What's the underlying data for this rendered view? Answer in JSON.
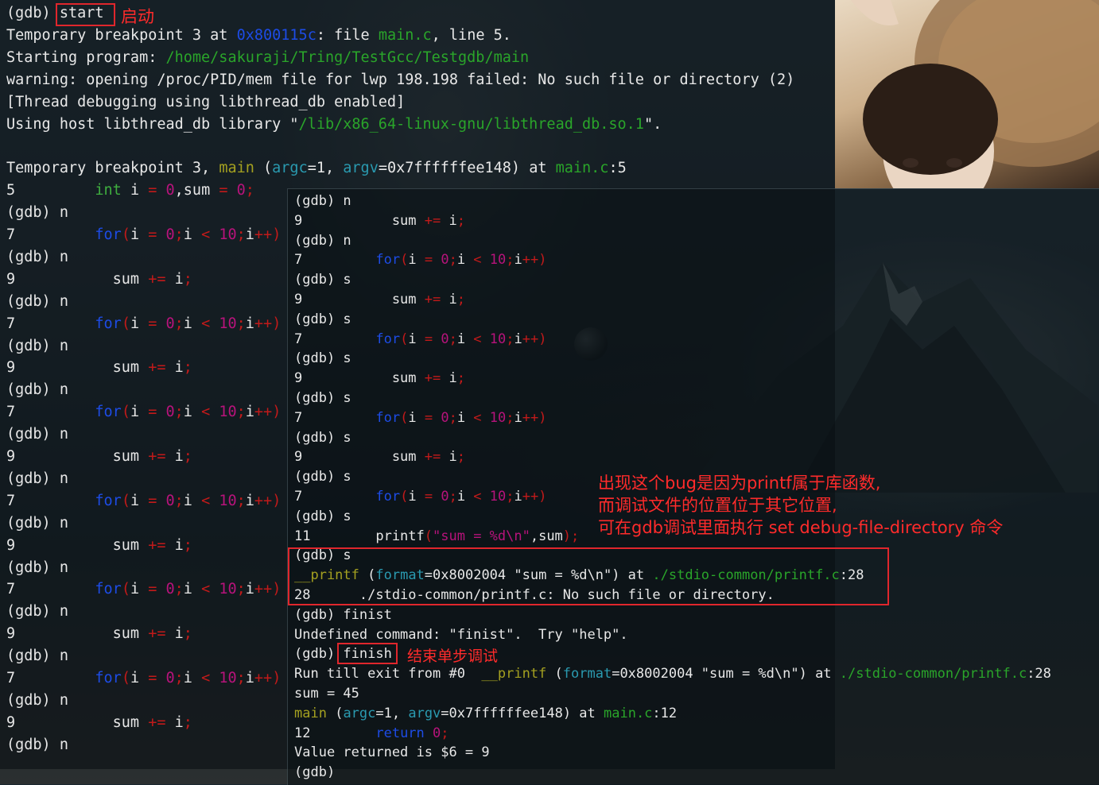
{
  "left_terminal": {
    "lines": [
      [
        [
          "(gdb) ",
          "white"
        ],
        [
          "start",
          "white"
        ]
      ],
      [
        [
          "Temporary breakpoint 3 at ",
          "white"
        ],
        [
          "0x800115c",
          "blue"
        ],
        [
          ": file ",
          "white"
        ],
        [
          "main.c",
          "green"
        ],
        [
          ", line 5.",
          "white"
        ]
      ],
      [
        [
          "Starting program: ",
          "white"
        ],
        [
          "/home/sakuraji/Tring/TestGcc/Testgdb/main",
          "green"
        ]
      ],
      [
        [
          "warning: opening /proc/PID/mem file for lwp 198.198 failed: No such file or directory (2)",
          "white"
        ]
      ],
      [
        [
          "[Thread debugging using libthread_db enabled]",
          "white"
        ]
      ],
      [
        [
          "Using host libthread_db library \"",
          "white"
        ],
        [
          "/lib/x86_64-linux-gnu/libthread_db.so.1",
          "green"
        ],
        [
          "\".",
          "white"
        ]
      ],
      [
        [
          "",
          "white"
        ]
      ],
      [
        [
          "Temporary breakpoint 3, ",
          "white"
        ],
        [
          "main",
          "olive"
        ],
        [
          " (",
          "white"
        ],
        [
          "argc",
          "cyan"
        ],
        [
          "=1, ",
          "white"
        ],
        [
          "argv",
          "cyan"
        ],
        [
          "=0x7ffffffee148) at ",
          "white"
        ],
        [
          "main.c",
          "green"
        ],
        [
          ":5",
          "white"
        ]
      ],
      [
        [
          "5         ",
          "white"
        ],
        [
          "int",
          "grn2"
        ],
        [
          " i ",
          "white"
        ],
        [
          "=",
          "red"
        ],
        [
          " ",
          "white"
        ],
        [
          "0",
          "mag"
        ],
        [
          ",sum ",
          "white"
        ],
        [
          "=",
          "red"
        ],
        [
          " ",
          "white"
        ],
        [
          "0",
          "mag"
        ],
        [
          ";",
          "red"
        ]
      ],
      [
        [
          "(gdb) n",
          "white"
        ]
      ],
      [
        [
          "7         ",
          "white"
        ],
        [
          "for",
          "blue"
        ],
        [
          "(",
          "red"
        ],
        [
          "i ",
          "white"
        ],
        [
          "=",
          "red"
        ],
        [
          " ",
          "white"
        ],
        [
          "0",
          "mag"
        ],
        [
          ";",
          "red"
        ],
        [
          "i ",
          "white"
        ],
        [
          "<",
          "red"
        ],
        [
          " ",
          "white"
        ],
        [
          "10",
          "mag"
        ],
        [
          ";",
          "red"
        ],
        [
          "i",
          "white"
        ],
        [
          "++",
          "red"
        ],
        [
          ")",
          "red"
        ]
      ],
      [
        [
          "(gdb) n",
          "white"
        ]
      ],
      [
        [
          "9           sum ",
          "white"
        ],
        [
          "+=",
          "red"
        ],
        [
          " i",
          "white"
        ],
        [
          ";",
          "red"
        ]
      ],
      [
        [
          "(gdb) n",
          "white"
        ]
      ],
      [
        [
          "7         ",
          "white"
        ],
        [
          "for",
          "blue"
        ],
        [
          "(",
          "red"
        ],
        [
          "i ",
          "white"
        ],
        [
          "=",
          "red"
        ],
        [
          " ",
          "white"
        ],
        [
          "0",
          "mag"
        ],
        [
          ";",
          "red"
        ],
        [
          "i ",
          "white"
        ],
        [
          "<",
          "red"
        ],
        [
          " ",
          "white"
        ],
        [
          "10",
          "mag"
        ],
        [
          ";",
          "red"
        ],
        [
          "i",
          "white"
        ],
        [
          "++",
          "red"
        ],
        [
          ")",
          "red"
        ]
      ],
      [
        [
          "(gdb) n",
          "white"
        ]
      ],
      [
        [
          "9           sum ",
          "white"
        ],
        [
          "+=",
          "red"
        ],
        [
          " i",
          "white"
        ],
        [
          ";",
          "red"
        ]
      ],
      [
        [
          "(gdb) n",
          "white"
        ]
      ],
      [
        [
          "7         ",
          "white"
        ],
        [
          "for",
          "blue"
        ],
        [
          "(",
          "red"
        ],
        [
          "i ",
          "white"
        ],
        [
          "=",
          "red"
        ],
        [
          " ",
          "white"
        ],
        [
          "0",
          "mag"
        ],
        [
          ";",
          "red"
        ],
        [
          "i ",
          "white"
        ],
        [
          "<",
          "red"
        ],
        [
          " ",
          "white"
        ],
        [
          "10",
          "mag"
        ],
        [
          ";",
          "red"
        ],
        [
          "i",
          "white"
        ],
        [
          "++",
          "red"
        ],
        [
          ")",
          "red"
        ]
      ],
      [
        [
          "(gdb) n",
          "white"
        ]
      ],
      [
        [
          "9           sum ",
          "white"
        ],
        [
          "+=",
          "red"
        ],
        [
          " i",
          "white"
        ],
        [
          ";",
          "red"
        ]
      ],
      [
        [
          "(gdb) n",
          "white"
        ]
      ],
      [
        [
          "7         ",
          "white"
        ],
        [
          "for",
          "blue"
        ],
        [
          "(",
          "red"
        ],
        [
          "i ",
          "white"
        ],
        [
          "=",
          "red"
        ],
        [
          " ",
          "white"
        ],
        [
          "0",
          "mag"
        ],
        [
          ";",
          "red"
        ],
        [
          "i ",
          "white"
        ],
        [
          "<",
          "red"
        ],
        [
          " ",
          "white"
        ],
        [
          "10",
          "mag"
        ],
        [
          ";",
          "red"
        ],
        [
          "i",
          "white"
        ],
        [
          "++",
          "red"
        ],
        [
          ")",
          "red"
        ]
      ],
      [
        [
          "(gdb) n",
          "white"
        ]
      ],
      [
        [
          "9           sum ",
          "white"
        ],
        [
          "+=",
          "red"
        ],
        [
          " i",
          "white"
        ],
        [
          ";",
          "red"
        ]
      ],
      [
        [
          "(gdb) n",
          "white"
        ]
      ],
      [
        [
          "7         ",
          "white"
        ],
        [
          "for",
          "blue"
        ],
        [
          "(",
          "red"
        ],
        [
          "i ",
          "white"
        ],
        [
          "=",
          "red"
        ],
        [
          " ",
          "white"
        ],
        [
          "0",
          "mag"
        ],
        [
          ";",
          "red"
        ],
        [
          "i ",
          "white"
        ],
        [
          "<",
          "red"
        ],
        [
          " ",
          "white"
        ],
        [
          "10",
          "mag"
        ],
        [
          ";",
          "red"
        ],
        [
          "i",
          "white"
        ],
        [
          "++",
          "red"
        ],
        [
          ")",
          "red"
        ]
      ],
      [
        [
          "(gdb) n",
          "white"
        ]
      ],
      [
        [
          "9           sum ",
          "white"
        ],
        [
          "+=",
          "red"
        ],
        [
          " i",
          "white"
        ],
        [
          ";",
          "red"
        ]
      ],
      [
        [
          "(gdb) n",
          "white"
        ]
      ],
      [
        [
          "7         ",
          "white"
        ],
        [
          "for",
          "blue"
        ],
        [
          "(",
          "red"
        ],
        [
          "i ",
          "white"
        ],
        [
          "=",
          "red"
        ],
        [
          " ",
          "white"
        ],
        [
          "0",
          "mag"
        ],
        [
          ";",
          "red"
        ],
        [
          "i ",
          "white"
        ],
        [
          "<",
          "red"
        ],
        [
          " ",
          "white"
        ],
        [
          "10",
          "mag"
        ],
        [
          ";",
          "red"
        ],
        [
          "i",
          "white"
        ],
        [
          "++",
          "red"
        ],
        [
          ")",
          "red"
        ]
      ],
      [
        [
          "(gdb) n",
          "white"
        ]
      ],
      [
        [
          "9           sum ",
          "white"
        ],
        [
          "+=",
          "red"
        ],
        [
          " i",
          "white"
        ],
        [
          ";",
          "red"
        ]
      ],
      [
        [
          "(gdb) n",
          "white"
        ]
      ]
    ]
  },
  "right_terminal": {
    "lines": [
      [
        [
          "(gdb) n",
          "white"
        ]
      ],
      [
        [
          "9           sum ",
          "white"
        ],
        [
          "+=",
          "red"
        ],
        [
          " i",
          "white"
        ],
        [
          ";",
          "red"
        ]
      ],
      [
        [
          "(gdb) n",
          "white"
        ]
      ],
      [
        [
          "7         ",
          "white"
        ],
        [
          "for",
          "blue"
        ],
        [
          "(",
          "red"
        ],
        [
          "i ",
          "white"
        ],
        [
          "=",
          "red"
        ],
        [
          " ",
          "white"
        ],
        [
          "0",
          "mag"
        ],
        [
          ";",
          "red"
        ],
        [
          "i ",
          "white"
        ],
        [
          "<",
          "red"
        ],
        [
          " ",
          "white"
        ],
        [
          "10",
          "mag"
        ],
        [
          ";",
          "red"
        ],
        [
          "i",
          "white"
        ],
        [
          "++",
          "red"
        ],
        [
          ")",
          "red"
        ]
      ],
      [
        [
          "(gdb) s",
          "white"
        ]
      ],
      [
        [
          "9           sum ",
          "white"
        ],
        [
          "+=",
          "red"
        ],
        [
          " i",
          "white"
        ],
        [
          ";",
          "red"
        ]
      ],
      [
        [
          "(gdb) s",
          "white"
        ]
      ],
      [
        [
          "7         ",
          "white"
        ],
        [
          "for",
          "blue"
        ],
        [
          "(",
          "red"
        ],
        [
          "i ",
          "white"
        ],
        [
          "=",
          "red"
        ],
        [
          " ",
          "white"
        ],
        [
          "0",
          "mag"
        ],
        [
          ";",
          "red"
        ],
        [
          "i ",
          "white"
        ],
        [
          "<",
          "red"
        ],
        [
          " ",
          "white"
        ],
        [
          "10",
          "mag"
        ],
        [
          ";",
          "red"
        ],
        [
          "i",
          "white"
        ],
        [
          "++",
          "red"
        ],
        [
          ")",
          "red"
        ]
      ],
      [
        [
          "(gdb) s",
          "white"
        ]
      ],
      [
        [
          "9           sum ",
          "white"
        ],
        [
          "+=",
          "red"
        ],
        [
          " i",
          "white"
        ],
        [
          ";",
          "red"
        ]
      ],
      [
        [
          "(gdb) s",
          "white"
        ]
      ],
      [
        [
          "7         ",
          "white"
        ],
        [
          "for",
          "blue"
        ],
        [
          "(",
          "red"
        ],
        [
          "i ",
          "white"
        ],
        [
          "=",
          "red"
        ],
        [
          " ",
          "white"
        ],
        [
          "0",
          "mag"
        ],
        [
          ";",
          "red"
        ],
        [
          "i ",
          "white"
        ],
        [
          "<",
          "red"
        ],
        [
          " ",
          "white"
        ],
        [
          "10",
          "mag"
        ],
        [
          ";",
          "red"
        ],
        [
          "i",
          "white"
        ],
        [
          "++",
          "red"
        ],
        [
          ")",
          "red"
        ]
      ],
      [
        [
          "(gdb) s",
          "white"
        ]
      ],
      [
        [
          "9           sum ",
          "white"
        ],
        [
          "+=",
          "red"
        ],
        [
          " i",
          "white"
        ],
        [
          ";",
          "red"
        ]
      ],
      [
        [
          "(gdb) s",
          "white"
        ]
      ],
      [
        [
          "7         ",
          "white"
        ],
        [
          "for",
          "blue"
        ],
        [
          "(",
          "red"
        ],
        [
          "i ",
          "white"
        ],
        [
          "=",
          "red"
        ],
        [
          " ",
          "white"
        ],
        [
          "0",
          "mag"
        ],
        [
          ";",
          "red"
        ],
        [
          "i ",
          "white"
        ],
        [
          "<",
          "red"
        ],
        [
          " ",
          "white"
        ],
        [
          "10",
          "mag"
        ],
        [
          ";",
          "red"
        ],
        [
          "i",
          "white"
        ],
        [
          "++",
          "red"
        ],
        [
          ")",
          "red"
        ]
      ],
      [
        [
          "(gdb) s",
          "white"
        ]
      ],
      [
        [
          "11        printf",
          "white"
        ],
        [
          "(",
          "red"
        ],
        [
          "\"sum = %d\\n\"",
          "mag"
        ],
        [
          ",sum",
          "white"
        ],
        [
          ");",
          "red"
        ]
      ],
      [
        [
          "(gdb) s",
          "white"
        ]
      ],
      [
        [
          "__printf",
          "olive"
        ],
        [
          " (",
          "white"
        ],
        [
          "format",
          "cyan"
        ],
        [
          "=0x8002004 \"sum = %d\\n\") at ",
          "white"
        ],
        [
          "./stdio-common/printf.c",
          "green"
        ],
        [
          ":28",
          "white"
        ]
      ],
      [
        [
          "28      ./stdio-common/printf.c: No such file or directory.",
          "white"
        ]
      ],
      [
        [
          "(gdb) finist",
          "white"
        ]
      ],
      [
        [
          "Undefined command: \"finist\".  Try \"help\".",
          "white"
        ]
      ],
      [
        [
          "(gdb) ",
          "white"
        ],
        [
          "finish",
          "white"
        ]
      ],
      [
        [
          "Run till exit from #0  ",
          "white"
        ],
        [
          "__printf",
          "olive"
        ],
        [
          " (",
          "white"
        ],
        [
          "format",
          "cyan"
        ],
        [
          "=0x8002004 \"sum = %d\\n\") at ",
          "white"
        ],
        [
          "./stdio-common/printf.c",
          "green"
        ],
        [
          ":28",
          "white"
        ]
      ],
      [
        [
          "sum = 45",
          "white"
        ]
      ],
      [
        [
          "main",
          "olive"
        ],
        [
          " (",
          "white"
        ],
        [
          "argc",
          "cyan"
        ],
        [
          "=1, ",
          "white"
        ],
        [
          "argv",
          "cyan"
        ],
        [
          "=0x7ffffffee148) at ",
          "white"
        ],
        [
          "main.c",
          "green"
        ],
        [
          ":12",
          "white"
        ]
      ],
      [
        [
          "12        ",
          "white"
        ],
        [
          "return",
          "blue"
        ],
        [
          " ",
          "white"
        ],
        [
          "0",
          "mag"
        ],
        [
          ";",
          "red"
        ]
      ],
      [
        [
          "Value returned is $6 = 9",
          "white"
        ]
      ],
      [
        [
          "(gdb)",
          "white"
        ]
      ]
    ]
  },
  "annotations": {
    "start_note": "启动",
    "finish_note": "结束单步调试",
    "bug_note_line1": "出现这个bug是因为printf属于库函数,",
    "bug_note_line2": "而调试文件的位置位于其它位置,",
    "bug_note_line3": "可在gdb调试里面执行 set debug-file-directory 命令"
  },
  "colors": {
    "white": "#e8e8e8",
    "blue": "#1d4ce6",
    "green": "#2aa52a",
    "grn2": "#3fae3f",
    "red": "#c21a1a",
    "mag": "#b7137b",
    "olive": "#a4a020",
    "cyan": "#2a9ab0",
    "annotation_red": "#ff2b2b"
  }
}
